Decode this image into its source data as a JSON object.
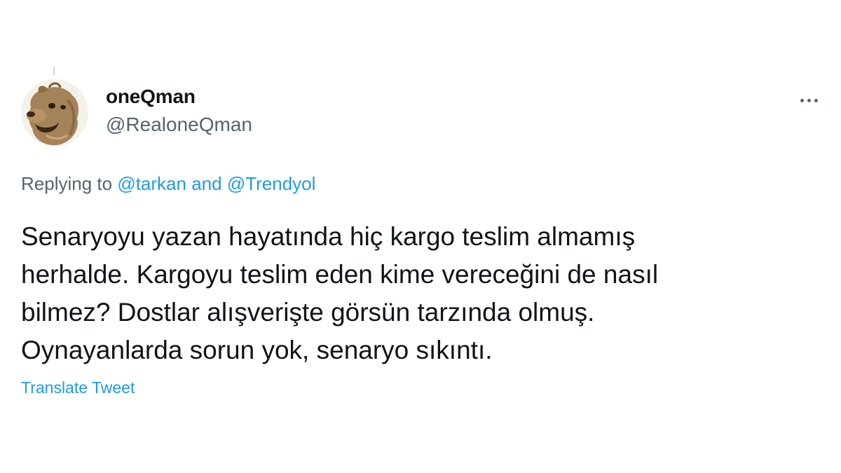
{
  "tweet": {
    "author": {
      "display_name": "oneQman",
      "handle": "@RealoneQman",
      "avatar_icon": "alf-avatar-icon"
    },
    "more_icon": "more-horizontal-icon",
    "replying": {
      "prefix": "Replying to",
      "mention_1": "@tarkan",
      "connector": "and",
      "mention_2": "@Trendyol"
    },
    "text_lines": [
      "Senaryoyu yazan hayatında hiç kargo teslim almamış",
      "herhalde. Kargoyu teslim eden kime vereceğini de nasıl",
      "bilmez? Dostlar alışverişte görsün tarzında olmuş.",
      "Oynayanlarda sorun yok, senaryo sıkıntı."
    ],
    "translate_label": "Translate Tweet"
  },
  "colors": {
    "text_primary": "#0f1419",
    "text_secondary": "#536471",
    "link": "#1d9bf0",
    "background": "#ffffff"
  }
}
